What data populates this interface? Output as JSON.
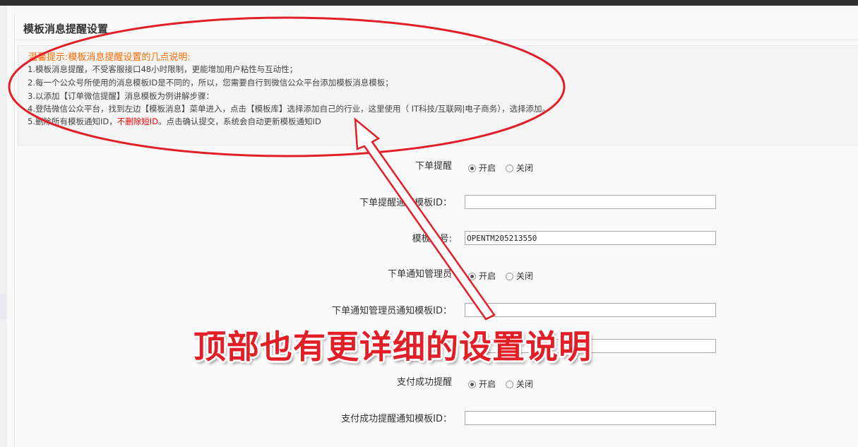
{
  "panel": {
    "title": "模板消息提醒设置"
  },
  "tips": {
    "title": "温馨提示:模板消息提醒设置的几点说明:",
    "lines": [
      "1.模板消息提醒，不受客服接口48小时限制，更能增加用户粘性与互动性；",
      "2.每一个公众号所使用的消息模板ID是不同的，所以，您需要自行到微信公众平台添加模板消息模板；",
      "3.以添加【订单微信提醒】消息模板为例讲解步骤：",
      "4.登陆微信公众平台，找到左边【模板消息】菜单进入，点击【模板库】选择添加自己的行业，这里使用（ IT科技/互联网|电子商务），选择添加。"
    ],
    "line5": {
      "prefix": "5.删除所有模板通知ID，",
      "highlight": "不删除短ID",
      "suffix": "。点击确认提交，系统会自动更新模板通知ID"
    }
  },
  "form": {
    "order_remind": {
      "label": "下单提醒",
      "on": "开启",
      "off": "关闭",
      "selected": "on"
    },
    "order_template_id": {
      "label": "下单提醒通知模板ID：",
      "value": ""
    },
    "template_no": {
      "label": "模板编号:",
      "value": "OPENTM205213550"
    },
    "admin_notify": {
      "label": "下单通知管理员",
      "on": "开启",
      "off": "关闭",
      "selected": "on"
    },
    "admin_template_id": {
      "label": "下单通知管理员通知模板ID：",
      "value": ""
    },
    "hidden_field": {
      "value": ""
    },
    "pay_success": {
      "label": "支付成功提醒",
      "on": "开启",
      "off": "关闭",
      "selected": "on"
    },
    "pay_template_id": {
      "label": "支付成功提醒通知模板ID：",
      "value": ""
    }
  },
  "annotation": {
    "callout": "顶部也有更详细的设置说明",
    "color": "#e21f26"
  }
}
